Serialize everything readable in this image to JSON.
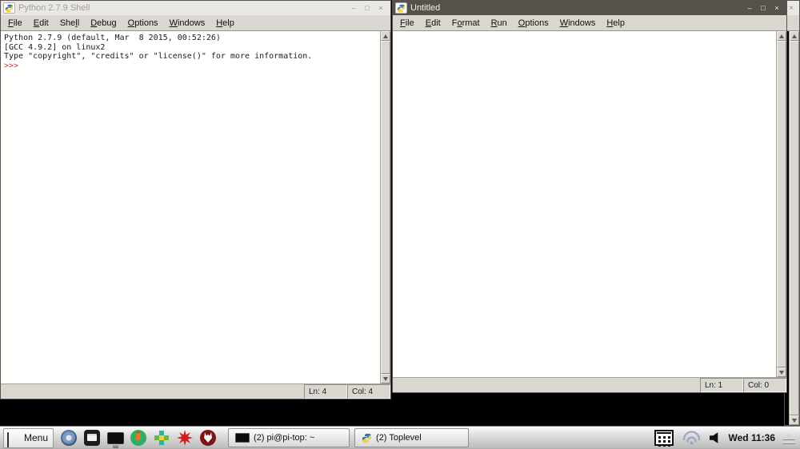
{
  "colors": {
    "desktop_background": "#000000",
    "active_titlebar": "#56524a",
    "inactive_titlebar": "#eae8e4",
    "menubar": "#d9d7d0",
    "console_prompt": "#b03a2e",
    "content_background": "#fffffe"
  },
  "shell_window": {
    "title": "Python 2.7.9 Shell",
    "controls": {
      "minimize": "–",
      "maximize": "□",
      "close": "×"
    },
    "menus": [
      {
        "pre": "",
        "u": "F",
        "post": "ile"
      },
      {
        "pre": "",
        "u": "E",
        "post": "dit"
      },
      {
        "pre": "She",
        "u": "l",
        "post": "l"
      },
      {
        "pre": "",
        "u": "D",
        "post": "ebug"
      },
      {
        "pre": "",
        "u": "O",
        "post": "ptions"
      },
      {
        "pre": "",
        "u": "W",
        "post": "indows"
      },
      {
        "pre": "",
        "u": "H",
        "post": "elp"
      }
    ],
    "console": {
      "lines": [
        "Python 2.7.9 (default, Mar  8 2015, 00:52:26)",
        "[GCC 4.9.2] on linux2",
        "Type \"copyright\", \"credits\" or \"license()\" for more information."
      ],
      "prompt": ">>>"
    },
    "status": {
      "line": "Ln: 4",
      "column": "Col: 4"
    }
  },
  "editor_window": {
    "title": "Untitled",
    "controls": {
      "minimize": "–",
      "maximize": "□",
      "close": "×"
    },
    "menus": [
      {
        "pre": "",
        "u": "F",
        "post": "ile"
      },
      {
        "pre": "",
        "u": "E",
        "post": "dit"
      },
      {
        "pre": "F",
        "u": "o",
        "post": "rmat"
      },
      {
        "pre": "",
        "u": "R",
        "post": "un"
      },
      {
        "pre": "",
        "u": "O",
        "post": "ptions"
      },
      {
        "pre": "",
        "u": "W",
        "post": "indows"
      },
      {
        "pre": "",
        "u": "H",
        "post": "elp"
      }
    ],
    "status": {
      "line": "Ln: 1",
      "column": "Col: 0"
    }
  },
  "background_window": {
    "controls": {
      "close": "×"
    }
  },
  "taskbar": {
    "menu_button": {
      "label": "Menu"
    },
    "launchers": [
      {
        "name": "chromium-browser-icon"
      },
      {
        "name": "file-manager-icon"
      },
      {
        "name": "terminal-icon"
      },
      {
        "name": "ceed-universe-icon"
      },
      {
        "name": "dashboard-icon"
      },
      {
        "name": "wolfram-icon"
      },
      {
        "name": "husky-icon"
      }
    ],
    "tasks": [
      {
        "label": "(2) pi@pi-top: ~"
      },
      {
        "label": "(2) Toplevel"
      }
    ],
    "tray": {
      "clock": "Wed 11:36"
    }
  }
}
